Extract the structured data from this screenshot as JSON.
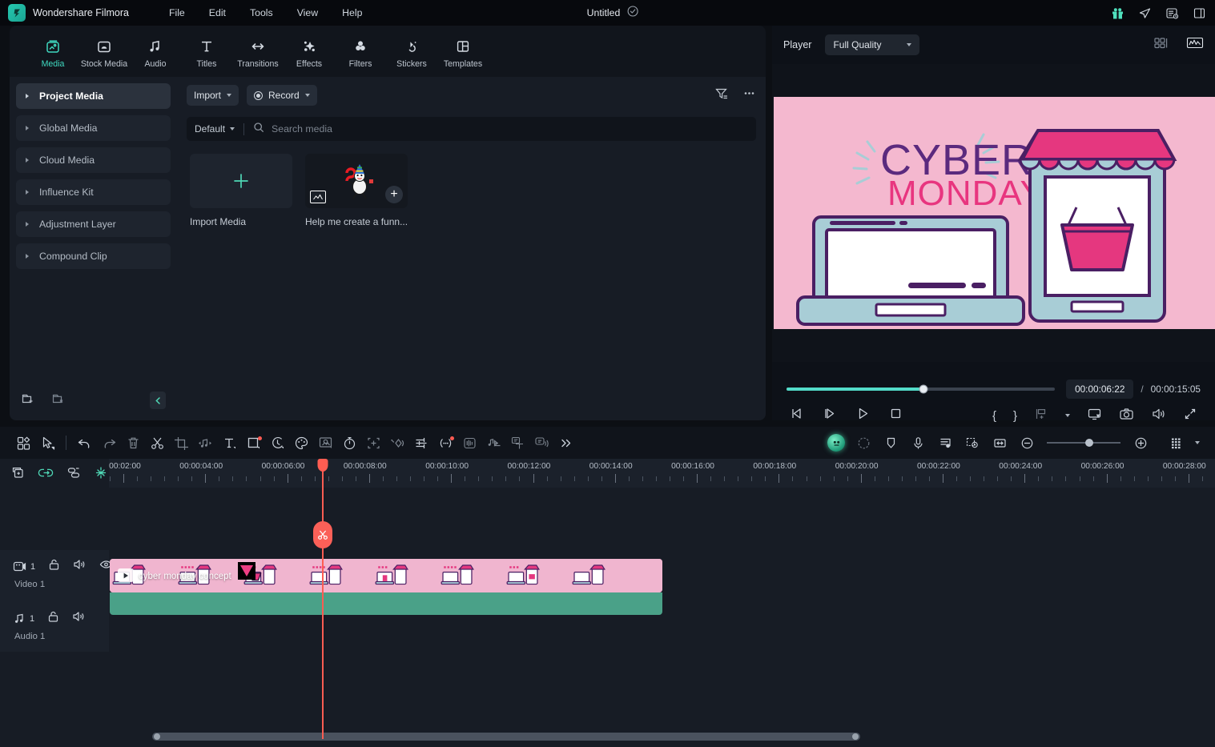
{
  "titlebar": {
    "brand": "Wondershare Filmora",
    "menus": [
      "File",
      "Edit",
      "Tools",
      "View",
      "Help"
    ],
    "project_title": "Untitled",
    "save_status_icon": "check-circle-icon",
    "right_icons": [
      "gift-icon",
      "send-icon",
      "notes-icon",
      "panel-icon"
    ]
  },
  "toolbar": {
    "tabs": [
      {
        "label": "Media",
        "icon": "media-icon",
        "active": true
      },
      {
        "label": "Stock Media",
        "icon": "stock-media-icon",
        "active": false
      },
      {
        "label": "Audio",
        "icon": "audio-note-icon",
        "active": false
      },
      {
        "label": "Titles",
        "icon": "titles-t-icon",
        "active": false
      },
      {
        "label": "Transitions",
        "icon": "transitions-arrow-icon",
        "active": false
      },
      {
        "label": "Effects",
        "icon": "effects-wand-icon",
        "active": false
      },
      {
        "label": "Filters",
        "icon": "filters-circles-icon",
        "active": false
      },
      {
        "label": "Stickers",
        "icon": "stickers-icon",
        "active": false
      },
      {
        "label": "Templates",
        "icon": "templates-grid-icon",
        "active": false
      }
    ]
  },
  "sidebar": {
    "items": [
      {
        "label": "Project Media",
        "active": true
      },
      {
        "label": "Global Media",
        "active": false
      },
      {
        "label": "Cloud Media",
        "active": false
      },
      {
        "label": "Influence Kit",
        "active": false
      },
      {
        "label": "Adjustment Layer",
        "active": false
      },
      {
        "label": "Compound Clip",
        "active": false
      }
    ],
    "bottom_icons": [
      "new-folder-icon",
      "delete-folder-icon"
    ],
    "collapse_icon": "chevron-left-icon"
  },
  "media_panel": {
    "import_label": "Import",
    "record_label": "Record",
    "filter_icon": "filter-icon",
    "more_icon": "more-options-icon",
    "sort_label": "Default",
    "search_placeholder": "Search media",
    "search_value": "",
    "items": [
      {
        "label": "Import Media",
        "type": "import-placeholder",
        "icon": "plus-icon"
      },
      {
        "label": "Help me create a funn...",
        "type": "media-thumb",
        "badge": "image-icon",
        "add": "+"
      }
    ]
  },
  "player": {
    "label": "Player",
    "quality": "Full Quality",
    "head_icons": [
      "layout-grid-icon",
      "waveform-icon"
    ],
    "current_time": "00:00:06:22",
    "separator": "/",
    "total_time": "00:00:15:05",
    "progress_percent": 51,
    "transport_icons": [
      "prev-frame-icon",
      "next-frame-icon",
      "play-icon",
      "stop-icon"
    ],
    "mark_in": "{",
    "mark_out": "}",
    "right_icons": [
      "marker-icon",
      "marker-chevron-icon",
      "screen-icon",
      "snapshot-icon",
      "volume-icon",
      "fullscreen-icon"
    ],
    "canvas": {
      "bg_color": "#f4b8cf",
      "headline_top": "CYBER",
      "headline_bottom": "MONDAY",
      "top_color": "#5b2a7e",
      "bottom_color": "#e8357f",
      "accent_teal": "#a8cdd6",
      "accent_pink": "#e5377f"
    }
  },
  "timeline_toolbar": {
    "left_icons": [
      "snapshot-grid-icon",
      "select-cursor-icon",
      "divider",
      "undo-icon",
      "redo-icon",
      "delete-icon",
      "split-scissors-icon",
      "crop-icon",
      "audio-detach-icon",
      "text-icon",
      "mask-icon",
      "speed-icon",
      "color-icon",
      "greenscreen-icon",
      "timer-icon",
      "motion-tracking-icon",
      "keyframe-icon",
      "adjust-sliders-icon",
      "silence-detect-icon",
      "audio-stretch-icon",
      "audio-ducking-icon",
      "auto-caption-icon",
      "speech-to-text-icon",
      "more-chevrons-icon"
    ],
    "right_icons": [
      "ai-assistant-orb",
      "render-preview-icon",
      "marker-icon",
      "voiceover-icon",
      "audio-mixer-icon",
      "snapshot-preview-icon",
      "fit-timeline-icon"
    ],
    "zoom_out_icon": "zoom-out-icon",
    "zoom_in_icon": "zoom-in-icon",
    "zoom_percent": 58,
    "view_icon": "timeline-view-icon",
    "view_chevron": "chevron-down-icon"
  },
  "timeline": {
    "header_icons": [
      "add-track-icon",
      "link-icon",
      "group-icon",
      "magnet-snap-icon"
    ],
    "ruler_labels": [
      "00:00:02:00",
      "00:00:04:00",
      "00:00:06:00",
      "00:00:08:00",
      "00:00:10:00",
      "00:00:12:00",
      "00:00:14:00",
      "00:00:16:00",
      "00:00:18:00",
      "00:00:20:00",
      "00:00:22:00",
      "00:00:24:00",
      "00:00:26:00",
      "00:00:28:00"
    ],
    "playhead_time": "00:00:06:22",
    "playhead_cut_icon": "scissors-icon",
    "tracks": [
      {
        "name": "Video 1",
        "number": "1",
        "type": "video",
        "icons": [
          "video-track-icon",
          "lock-open-icon",
          "mute-icon",
          "eye-icon"
        ]
      },
      {
        "name": "Audio 1",
        "number": "1",
        "type": "audio",
        "icons": [
          "audio-track-icon",
          "lock-open-icon",
          "mute-icon"
        ]
      }
    ],
    "clips": [
      {
        "track": "Video 1",
        "title": "cyber monday concept",
        "color": "#f0b5cf",
        "audio_color": "#4aa188"
      }
    ],
    "scrollbar": {
      "left_handle": "scroll-left-handle",
      "right_handle": "scroll-right-handle"
    }
  }
}
